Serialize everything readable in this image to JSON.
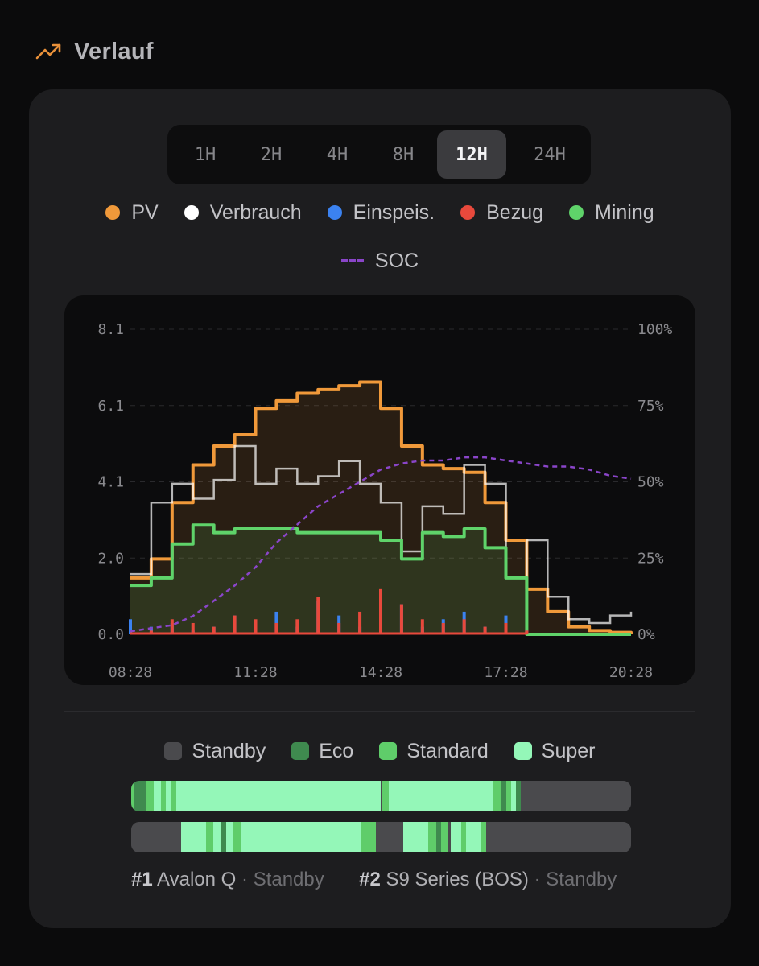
{
  "header": {
    "title": "Verlauf",
    "icon": "trending-up-icon"
  },
  "ranges": [
    {
      "label": "1H",
      "active": false
    },
    {
      "label": "2H",
      "active": false
    },
    {
      "label": "4H",
      "active": false
    },
    {
      "label": "8H",
      "active": false
    },
    {
      "label": "12H",
      "active": true
    },
    {
      "label": "24H",
      "active": false
    }
  ],
  "legend": {
    "pv": "PV",
    "verbrauch": "Verbrauch",
    "einspeis": "Einspeis.",
    "bezug": "Bezug",
    "mining": "Mining",
    "soc": "SOC"
  },
  "colors": {
    "pv": "#f0993a",
    "verbrauch": "#ffffff",
    "einspeis": "#3b82f0",
    "bezug": "#e8493c",
    "mining": "#5fd36a",
    "soc": "#8a45c9",
    "standby": "#4a4a4d",
    "eco": "#3f8a4f",
    "standard": "#5fcd6a",
    "super": "#94f7b8"
  },
  "chart_data": {
    "type": "line",
    "title": "",
    "x_ticks": [
      "08:28",
      "11:28",
      "14:28",
      "17:28",
      "20:28"
    ],
    "y_left_ticks": [
      "8.1",
      "6.1",
      "4.1",
      "2.0",
      "0.0"
    ],
    "y_right_ticks": [
      "100%",
      "75%",
      "50%",
      "25%",
      "0%"
    ],
    "ylim": [
      0,
      8.1
    ],
    "y2lim": [
      0,
      100
    ],
    "x_hours": [
      0,
      0.5,
      1,
      1.5,
      2,
      2.5,
      3,
      3.5,
      4,
      4.5,
      5,
      5.5,
      6,
      6.5,
      7,
      7.5,
      8,
      8.5,
      9,
      9.5,
      10,
      10.5,
      11,
      11.5,
      12
    ],
    "series": [
      {
        "name": "PV",
        "key": "pv",
        "area": true,
        "values": [
          1.5,
          2.0,
          3.5,
          4.5,
          5.0,
          5.3,
          6.0,
          6.2,
          6.4,
          6.5,
          6.6,
          6.7,
          6.0,
          5.0,
          4.5,
          4.4,
          4.3,
          3.5,
          2.5,
          1.2,
          0.6,
          0.2,
          0.1,
          0.05,
          0.0
        ]
      },
      {
        "name": "Verbrauch",
        "key": "verbrauch",
        "area": false,
        "values": [
          1.6,
          3.5,
          4.0,
          3.6,
          4.1,
          5.0,
          4.0,
          4.4,
          4.0,
          4.2,
          4.6,
          4.0,
          3.5,
          2.2,
          3.4,
          3.2,
          4.5,
          4.0,
          1.5,
          2.5,
          1.0,
          0.4,
          0.3,
          0.5,
          0.6
        ]
      },
      {
        "name": "Mining",
        "key": "mining",
        "area": true,
        "values": [
          1.3,
          1.5,
          2.4,
          2.9,
          2.7,
          2.8,
          2.8,
          2.8,
          2.7,
          2.7,
          2.7,
          2.7,
          2.5,
          2.0,
          2.7,
          2.6,
          2.8,
          2.3,
          1.5,
          0.0,
          0.0,
          0.0,
          0.0,
          0.0,
          0.0
        ]
      },
      {
        "name": "Einspeis.",
        "key": "einspeis",
        "area": false,
        "values": [
          0.4,
          0.2,
          0.3,
          0.1,
          0.2,
          0.5,
          0.3,
          0.6,
          0.2,
          0.9,
          0.5,
          0.2,
          0.4,
          0.8,
          0.2,
          0.4,
          0.6,
          0.2,
          0.5,
          0.1,
          0.0,
          0.0,
          0.0,
          0.0,
          0.0
        ]
      },
      {
        "name": "Bezug",
        "key": "bezug",
        "area": false,
        "values": [
          0.0,
          0.1,
          0.4,
          0.3,
          0.2,
          0.5,
          0.4,
          0.3,
          0.4,
          1.0,
          0.3,
          0.6,
          1.2,
          0.8,
          0.4,
          0.3,
          0.4,
          0.2,
          0.3,
          0.1,
          0.0,
          0.0,
          0.0,
          0.0,
          0.0
        ]
      },
      {
        "name": "SOC",
        "key": "soc",
        "axis": "right",
        "dashed": true,
        "values": [
          1,
          2,
          3,
          6,
          11,
          16,
          22,
          30,
          36,
          42,
          46,
          50,
          54,
          56,
          57,
          57,
          58,
          58,
          57,
          56,
          55,
          55,
          54,
          52,
          51
        ]
      }
    ]
  },
  "mode_legend": {
    "standby": "Standby",
    "eco": "Eco",
    "standard": "Standard",
    "super": "Super"
  },
  "mode_timelines": [
    [
      [
        "standard",
        0,
        0.005
      ],
      [
        "eco",
        0.005,
        0.03
      ],
      [
        "standard",
        0.03,
        0.045
      ],
      [
        "super",
        0.045,
        0.06
      ],
      [
        "standard",
        0.06,
        0.07
      ],
      [
        "super",
        0.07,
        0.08
      ],
      [
        "standard",
        0.08,
        0.09
      ],
      [
        "super",
        0.09,
        0.5
      ],
      [
        "standard",
        0.5,
        0.515
      ],
      [
        "super",
        0.515,
        0.725
      ],
      [
        "standard",
        0.725,
        0.74
      ],
      [
        "eco",
        0.74,
        0.75
      ],
      [
        "standard",
        0.75,
        0.76
      ],
      [
        "super",
        0.76,
        0.77
      ],
      [
        "eco",
        0.77,
        0.78
      ],
      [
        "standby",
        0.78,
        1
      ]
    ],
    [
      [
        "standby",
        0,
        0.1
      ],
      [
        "super",
        0.1,
        0.15
      ],
      [
        "standard",
        0.15,
        0.165
      ],
      [
        "super",
        0.165,
        0.18
      ],
      [
        "eco",
        0.18,
        0.19
      ],
      [
        "super",
        0.19,
        0.205
      ],
      [
        "standard",
        0.205,
        0.22
      ],
      [
        "super",
        0.22,
        0.46
      ],
      [
        "standard",
        0.46,
        0.49
      ],
      [
        "standby",
        0.49,
        0.545
      ],
      [
        "super",
        0.545,
        0.595
      ],
      [
        "standard",
        0.595,
        0.61
      ],
      [
        "eco",
        0.61,
        0.62
      ],
      [
        "standard",
        0.62,
        0.635
      ],
      [
        "standby",
        0.635,
        0.64
      ],
      [
        "super",
        0.64,
        0.66
      ],
      [
        "standard",
        0.66,
        0.67
      ],
      [
        "super",
        0.67,
        0.7
      ],
      [
        "standard",
        0.7,
        0.71
      ],
      [
        "standby",
        0.71,
        1
      ]
    ]
  ],
  "miners": [
    {
      "num": "#1",
      "name": "Avalon Q",
      "status": "Standby"
    },
    {
      "num": "#2",
      "name": "S9 Series (BOS)",
      "status": "Standby"
    }
  ],
  "separator": "·"
}
